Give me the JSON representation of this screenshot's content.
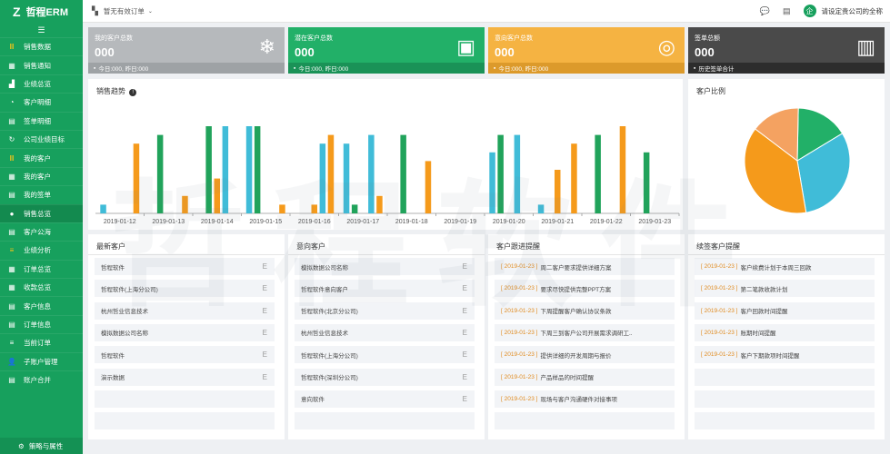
{
  "app": {
    "brand": "哲程ERM",
    "logo": "Z"
  },
  "sidebar": {
    "collapse_icon": "list-icon",
    "items": [
      {
        "label": "销售数据",
        "icon": "bars-icon",
        "style": "hl"
      },
      {
        "label": "销售通知",
        "icon": "table-icon",
        "style": ""
      },
      {
        "label": "业绩总览",
        "icon": "chart-icon",
        "style": ""
      },
      {
        "label": "客户明细",
        "icon": "pie-icon",
        "style": ""
      },
      {
        "label": "签单明细",
        "icon": "doc-icon",
        "style": ""
      },
      {
        "label": "公司业绩目标",
        "icon": "refresh-icon",
        "style": ""
      },
      {
        "label": "我的客户",
        "icon": "bars-icon",
        "style": "hl"
      },
      {
        "label": "我的客户",
        "icon": "table-icon",
        "style": ""
      },
      {
        "label": "我的签单",
        "icon": "doc-icon",
        "style": ""
      },
      {
        "label": "销售总览",
        "icon": "circle-icon",
        "style": "dark"
      },
      {
        "label": "客户公海",
        "icon": "doc-icon",
        "style": ""
      },
      {
        "label": "业绩分析",
        "icon": "menu-icon",
        "style": "hl"
      },
      {
        "label": "订单总览",
        "icon": "table-icon",
        "style": ""
      },
      {
        "label": "收款总览",
        "icon": "table-icon",
        "style": ""
      },
      {
        "label": "客户信息",
        "icon": "doc-icon",
        "style": ""
      },
      {
        "label": "订单信息",
        "icon": "doc-icon",
        "style": ""
      },
      {
        "label": "当前订单",
        "icon": "menu-icon",
        "style": ""
      },
      {
        "label": "子账户管理",
        "icon": "user-icon",
        "style": ""
      },
      {
        "label": "账户合并",
        "icon": "doc-icon",
        "style": ""
      }
    ],
    "footer": "策略与属性"
  },
  "topbar": {
    "notice": "暂无有效订单",
    "company": "请设定贵公司的全称",
    "avatar_text": "企"
  },
  "cards": [
    {
      "title": "我的客户总数",
      "value": "000",
      "footer": "今日:000, 昨日:000",
      "color": "#b6b9bc",
      "footer_color": "#9ea2a5",
      "icon": "snowflake-icon",
      "glyph": "❄"
    },
    {
      "title": "潜在客户总数",
      "value": "000",
      "footer": "今日:000, 昨日:000",
      "color": "#22b068",
      "footer_color": "#1a9257",
      "icon": "contact-card-icon",
      "glyph": "▣"
    },
    {
      "title": "意向客户总数",
      "value": "000",
      "footer": "今日:000, 昨日:000",
      "color": "#f5b342",
      "footer_color": "#dc9a2b",
      "icon": "ring-icon",
      "glyph": "◎"
    },
    {
      "title": "签单总额",
      "value": "000",
      "footer": "历史签单合计",
      "color": "#4a4a4a",
      "footer_color": "#2d2d2d",
      "icon": "bar-chart-icon",
      "glyph": "▥"
    }
  ],
  "sales_trend": {
    "title": "销售趋势",
    "info_icon": "info-icon"
  },
  "chart_data": [
    {
      "type": "bar",
      "title": "销售趋势",
      "categories": [
        "2019-01-12",
        "2019-01-13",
        "2019-01-14",
        "2019-01-15",
        "2019-01-16",
        "2019-01-17",
        "2019-01-18",
        "2019-01-19",
        "2019-01-20",
        "2019-01-21",
        "2019-01-22",
        "2019-01-23"
      ],
      "series": [
        {
          "color": "#40bcd8",
          "values": [
            1,
            0,
            0,
            10,
            0,
            8,
            0,
            0,
            7,
            1,
            0,
            0
          ]
        },
        {
          "color": "#21a35b",
          "values": [
            0,
            9,
            10,
            10,
            0,
            1,
            9,
            0,
            9,
            0,
            9,
            7
          ]
        },
        {
          "color": "#f59a1b",
          "values": [
            0,
            0,
            4,
            0,
            1,
            0,
            0,
            0,
            0,
            5,
            0,
            0
          ]
        },
        {
          "color": "#40bcd8",
          "values": [
            0,
            0,
            10,
            0,
            8,
            9,
            0,
            0,
            9,
            0,
            0,
            0
          ]
        },
        {
          "color": "#f59a1b",
          "values": [
            8,
            2,
            0,
            1,
            9,
            2,
            6,
            0,
            0,
            8,
            10,
            0
          ]
        }
      ],
      "ylim": [
        0,
        10
      ]
    },
    {
      "type": "pie",
      "title": "客户比例",
      "values": [
        16,
        31,
        38,
        15
      ],
      "colors": [
        "#22b068",
        "#40bcd8",
        "#f59a1b",
        "#f4a261"
      ]
    }
  ],
  "panels": [
    {
      "title": "最新客户",
      "kind": "plain",
      "rows": [
        "哲程软件",
        "哲程软件(上海分公司)",
        "杭州哲业信息技术",
        "模拟数据公司名称",
        "哲程软件",
        "演示数据",
        "",
        ""
      ]
    },
    {
      "title": "意向客户",
      "kind": "plain",
      "rows": [
        "模拟数据公司名称",
        "哲程软件意向客户",
        "哲程软件(北京分公司)",
        "杭州哲业信息技术",
        "哲程软件(上海分公司)",
        "哲程软件(深圳分公司)",
        "意向软件",
        ""
      ]
    },
    {
      "title": "客户跟进提醒",
      "kind": "dated",
      "rows": [
        {
          "date": "[ 2019-01-23 ]",
          "text": "周二客户要求提供详细方案"
        },
        {
          "date": "[ 2019-01-23 ]",
          "text": "要求尽快提供完整PPT方案"
        },
        {
          "date": "[ 2019-01-23 ]",
          "text": "下周提醒客户确认协议条款"
        },
        {
          "date": "[ 2019-01-23 ]",
          "text": "下周三到客户公司开展需求调研工.."
        },
        {
          "date": "[ 2019-01-23 ]",
          "text": "提供详细的开发周期与报价"
        },
        {
          "date": "[ 2019-01-23 ]",
          "text": "产品样品的时间提醒"
        },
        {
          "date": "[ 2019-01-23 ]",
          "text": "现场与客户沟通硬件对接事项"
        },
        {
          "date": "",
          "text": ""
        }
      ]
    },
    {
      "title": "续签客户提醒",
      "kind": "dated",
      "rows": [
        {
          "date": "[ 2019-01-23 ]",
          "text": "客户续费计划于本周三回款"
        },
        {
          "date": "[ 2019-01-23 ]",
          "text": "第二笔款收款计划"
        },
        {
          "date": "[ 2019-01-23 ]",
          "text": "客户回款时间提醒"
        },
        {
          "date": "[ 2019-01-23 ]",
          "text": "账期时间提醒"
        },
        {
          "date": "[ 2019-01-23 ]",
          "text": "客户下期款项时间提醒"
        },
        {
          "date": "",
          "text": ""
        },
        {
          "date": "",
          "text": ""
        },
        {
          "date": "",
          "text": ""
        }
      ]
    }
  ],
  "row_edit_glyph": "E",
  "watermark": "哲程软件"
}
